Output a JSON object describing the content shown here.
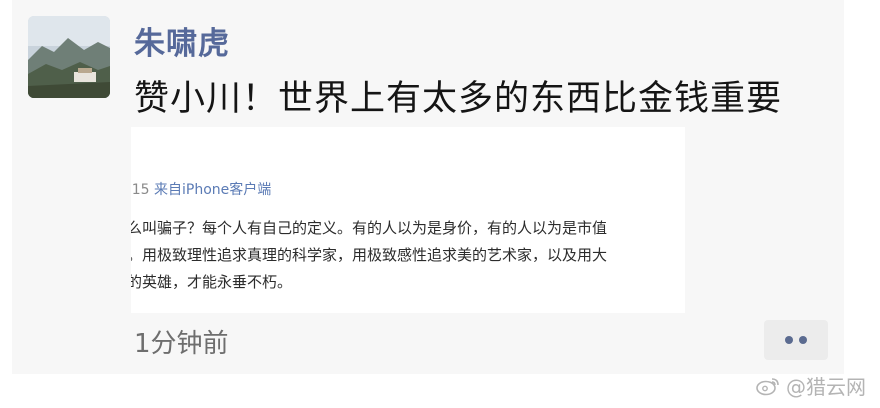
{
  "post": {
    "username": "朱啸虎",
    "text": "赞小川！世界上有太多的东西比金钱重要",
    "timestamp": "1分钟前"
  },
  "embed": {
    "time": ":15",
    "source": "来自iPhone客户端",
    "lines": [
      "么叫骗子？每个人有自己的定义。有的人以为是身价，有的人以为是市值",
      "。用极致理性追求真理的科学家，用极致感性追求美的艺术家，以及用大",
      "的英雄，才能永垂不朽。"
    ]
  },
  "more_button": {
    "icon": "more-dots-icon"
  },
  "watermark": {
    "text": "@猎云网"
  }
}
